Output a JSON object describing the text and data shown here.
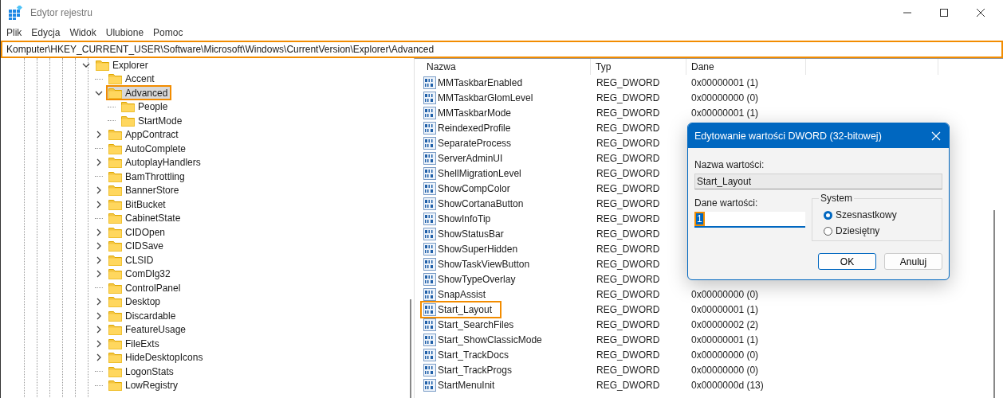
{
  "window": {
    "title": "Edytor rejestru"
  },
  "menu": [
    "Plik",
    "Edycja",
    "Widok",
    "Ulubione",
    "Pomoc"
  ],
  "address": {
    "path": "Komputer\\HKEY_CURRENT_USER\\Software\\Microsoft\\Windows\\CurrentVersion\\Explorer\\Advanced",
    "highlighted": true
  },
  "tree": [
    {
      "label": "Explorer",
      "expanded": true,
      "selected": false,
      "highlighted": false,
      "children": [
        {
          "label": "Accent",
          "selected": false,
          "highlighted": false
        },
        {
          "label": "Advanced",
          "expanded": true,
          "selected": true,
          "highlighted": true,
          "children": [
            {
              "label": "People",
              "selected": false,
              "highlighted": false
            },
            {
              "label": "StartMode",
              "selected": false,
              "highlighted": false
            }
          ]
        },
        {
          "label": "AppContract",
          "expanded": false,
          "selected": false,
          "highlighted": false
        },
        {
          "label": "AutoComplete",
          "selected": false,
          "highlighted": false
        },
        {
          "label": "AutoplayHandlers",
          "expanded": false,
          "selected": false,
          "highlighted": false
        },
        {
          "label": "BamThrottling",
          "selected": false,
          "highlighted": false
        },
        {
          "label": "BannerStore",
          "expanded": false,
          "selected": false,
          "highlighted": false
        },
        {
          "label": "BitBucket",
          "expanded": false,
          "selected": false,
          "highlighted": false
        },
        {
          "label": "CabinetState",
          "selected": false,
          "highlighted": false
        },
        {
          "label": "CIDOpen",
          "expanded": false,
          "selected": false,
          "highlighted": false
        },
        {
          "label": "CIDSave",
          "expanded": false,
          "selected": false,
          "highlighted": false
        },
        {
          "label": "CLSID",
          "expanded": false,
          "selected": false,
          "highlighted": false
        },
        {
          "label": "ComDlg32",
          "expanded": false,
          "selected": false,
          "highlighted": false
        },
        {
          "label": "ControlPanel",
          "selected": false,
          "highlighted": false
        },
        {
          "label": "Desktop",
          "expanded": false,
          "selected": false,
          "highlighted": false
        },
        {
          "label": "Discardable",
          "expanded": false,
          "selected": false,
          "highlighted": false
        },
        {
          "label": "FeatureUsage",
          "expanded": false,
          "selected": false,
          "highlighted": false
        },
        {
          "label": "FileExts",
          "expanded": false,
          "selected": false,
          "highlighted": false
        },
        {
          "label": "HideDesktopIcons",
          "expanded": false,
          "selected": false,
          "highlighted": false
        },
        {
          "label": "LogonStats",
          "selected": false,
          "highlighted": false
        },
        {
          "label": "LowRegistry",
          "selected": false,
          "highlighted": false
        }
      ]
    }
  ],
  "values": {
    "columns": [
      "Nazwa",
      "Typ",
      "Dane"
    ],
    "rows": [
      {
        "name": "MMTaskbarEnabled",
        "type": "REG_DWORD",
        "data": "0x00000001 (1)",
        "highlighted": false
      },
      {
        "name": "MMTaskbarGlomLevel",
        "type": "REG_DWORD",
        "data": "0x00000000 (0)",
        "highlighted": false
      },
      {
        "name": "MMTaskbarMode",
        "type": "REG_DWORD",
        "data": "0x00000001 (1)",
        "highlighted": false
      },
      {
        "name": "ReindexedProfile",
        "type": "REG_DWORD",
        "highlighted": false
      },
      {
        "name": "SeparateProcess",
        "type": "REG_DWORD",
        "highlighted": false
      },
      {
        "name": "ServerAdminUI",
        "type": "REG_DWORD",
        "highlighted": false
      },
      {
        "name": "ShellMigrationLevel",
        "type": "REG_DWORD",
        "highlighted": false
      },
      {
        "name": "ShowCompColor",
        "type": "REG_DWORD",
        "highlighted": false
      },
      {
        "name": "ShowCortanaButton",
        "type": "REG_DWORD",
        "highlighted": false
      },
      {
        "name": "ShowInfoTip",
        "type": "REG_DWORD",
        "highlighted": false
      },
      {
        "name": "ShowStatusBar",
        "type": "REG_DWORD",
        "highlighted": false
      },
      {
        "name": "ShowSuperHidden",
        "type": "REG_DWORD",
        "highlighted": false
      },
      {
        "name": "ShowTaskViewButton",
        "type": "REG_DWORD",
        "highlighted": false
      },
      {
        "name": "ShowTypeOverlay",
        "type": "REG_DWORD",
        "highlighted": false
      },
      {
        "name": "SnapAssist",
        "type": "REG_DWORD",
        "data": "0x00000000 (0)",
        "highlighted": false
      },
      {
        "name": "Start_Layout",
        "type": "REG_DWORD",
        "data": "0x00000001 (1)",
        "highlighted": true
      },
      {
        "name": "Start_SearchFiles",
        "type": "REG_DWORD",
        "data": "0x00000002 (2)",
        "highlighted": false
      },
      {
        "name": "Start_ShowClassicMode",
        "type": "REG_DWORD",
        "data": "0x00000001 (1)",
        "highlighted": false
      },
      {
        "name": "Start_TrackDocs",
        "type": "REG_DWORD",
        "data": "0x00000000 (0)",
        "highlighted": false
      },
      {
        "name": "Start_TrackProgs",
        "type": "REG_DWORD",
        "data": "0x00000000 (0)",
        "highlighted": false
      },
      {
        "name": "StartMenuInit",
        "type": "REG_DWORD",
        "data": "0x0000000d (13)",
        "highlighted": false
      }
    ]
  },
  "dialog": {
    "title": "Edytowanie wartości DWORD (32-bitowej)",
    "name_label": "Nazwa wartości:",
    "name_value": "Start_Layout",
    "data_label": "Dane wartości:",
    "data_value": "1",
    "data_highlighted": true,
    "base_label": "System",
    "bases": [
      {
        "label": "Szesnastkowy",
        "selected": true
      },
      {
        "label": "Dziesiętny",
        "selected": false
      }
    ],
    "buttons": [
      {
        "label": "OK",
        "default": true
      },
      {
        "label": "Anuluj",
        "default": false
      }
    ]
  }
}
